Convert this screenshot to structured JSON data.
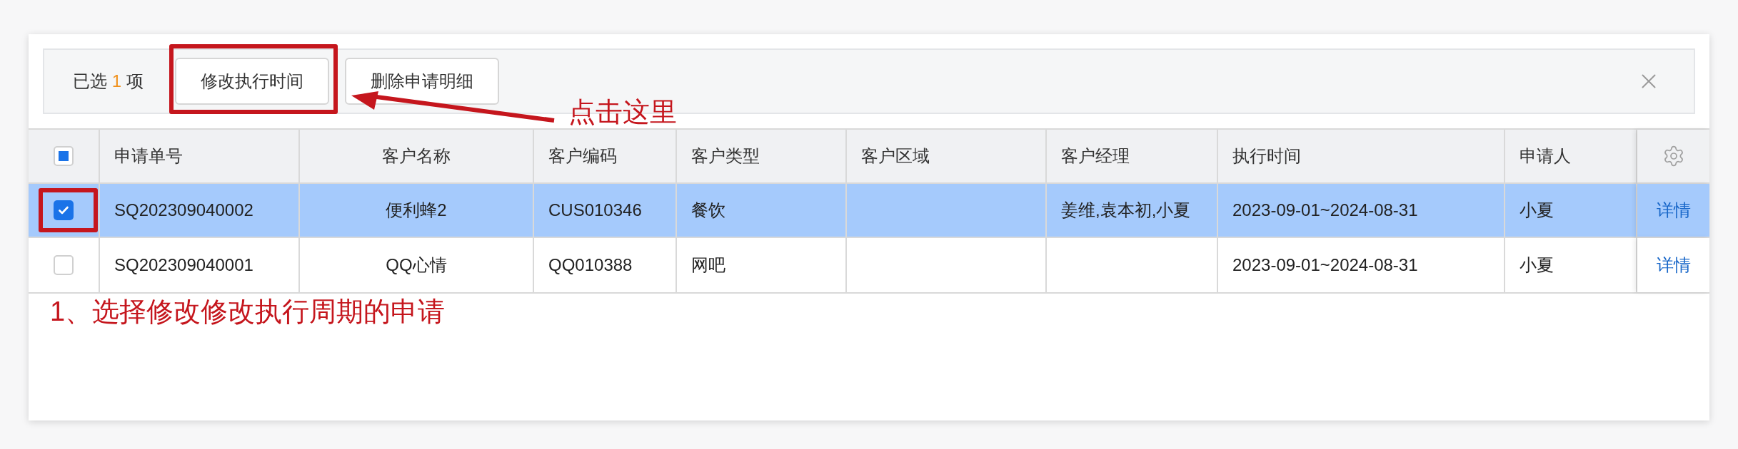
{
  "selection": {
    "prefix": "已选",
    "count": "1",
    "suffix": "项"
  },
  "toolbar_buttons": [
    {
      "label": "修改执行时间"
    },
    {
      "label": "删除申请明细"
    }
  ],
  "table": {
    "header_checkbox": {
      "checked": false,
      "indeterminate": true
    },
    "columns": [
      "申请单号",
      "客户名称",
      "客户编码",
      "客户类型",
      "客户区域",
      "客户经理",
      "执行时间",
      "申请人"
    ],
    "rows": [
      {
        "selected": true,
        "checked": true,
        "cells": [
          "SQ202309040002",
          "便利蜂2",
          "CUS010346",
          "餐饮",
          "",
          "姜维,袁本初,小夏",
          "2023-09-01~2024-08-31",
          "小夏"
        ],
        "action": "详情"
      },
      {
        "selected": false,
        "checked": false,
        "cells": [
          "SQ202309040001",
          "QQ心情",
          "QQ010388",
          "网吧",
          "",
          "",
          "2023-09-01~2024-08-31",
          "小夏"
        ],
        "action": "详情"
      }
    ]
  },
  "annotations": [
    {
      "kind": "box"
    },
    {
      "kind": "arrow"
    },
    {
      "kind": "text",
      "text": "点击这里"
    },
    {
      "kind": "box"
    },
    {
      "kind": "text",
      "text": "1、选择修改修改执行周期的申请"
    }
  ]
}
